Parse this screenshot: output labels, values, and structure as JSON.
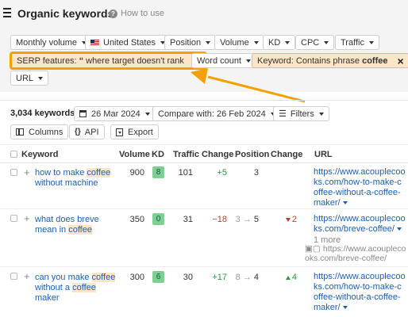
{
  "header": {
    "title": "Organic keywords",
    "help_label": "How to use"
  },
  "filters": {
    "monthly_volume": "Monthly volume",
    "country": "United States",
    "position": "Position",
    "volume": "Volume",
    "kd": "KD",
    "cpc": "CPC",
    "traffic": "Traffic",
    "serp_prefix": "SERP features:",
    "serp_suffix": "where target doesn't rank",
    "word_count": "Word count",
    "keyword_prefix": "Keyword: Contains phrase",
    "keyword_term": "coffee",
    "url": "URL"
  },
  "toolbar": {
    "count": "3,034 keywords",
    "date": "26 Mar 2024",
    "compare": "Compare with: 26 Feb 2024",
    "filters": "Filters",
    "columns": "Columns",
    "api": "API",
    "export": "Export"
  },
  "table": {
    "headers": {
      "keyword": "Keyword",
      "volume": "Volume",
      "kd": "KD",
      "traffic": "Traffic",
      "change": "Change",
      "position": "Position",
      "change2": "Change",
      "url": "URL"
    },
    "rows": [
      {
        "kw_a": "how to make ",
        "kw_hl": "coffee",
        "kw_b": " without machine",
        "volume": "900",
        "kd": "8",
        "traffic": "101",
        "change": "+5",
        "position": "3",
        "url": "https://www.acouplecooks.com/how-to-make-coffee-without-a-coffee-maker/"
      },
      {
        "kw_a": "what does breve mean in ",
        "kw_hl": "coffee",
        "kw_b": "",
        "volume": "350",
        "kd": "0",
        "traffic": "31",
        "change": "−18",
        "pos_from": "3",
        "pos_to": "5",
        "pos_change": "2",
        "url": "https://www.acouplecooks.com/breve-coffee/",
        "more": "1 more",
        "extra_url": "https://www.acouplecooks.com/breve-coffee/"
      },
      {
        "kw_a": "can you make ",
        "kw_hl": "coffee",
        "kw_b": " without a ",
        "kw_hl2": "coffee",
        "kw_c": " maker",
        "volume": "300",
        "kd": "6",
        "traffic": "30",
        "change": "+17",
        "pos_from": "8",
        "pos_to": "4",
        "pos_change": "4",
        "url": "https://www.acouplecooks.com/how-to-make-coffee-without-a-coffee-maker/"
      }
    ]
  },
  "colors": {
    "accent_orange": "#f6a000",
    "link_blue": "#1a5fb4",
    "kd_green": "#7fcf93",
    "positive": "#2b9a3d",
    "negative": "#c0392b"
  }
}
